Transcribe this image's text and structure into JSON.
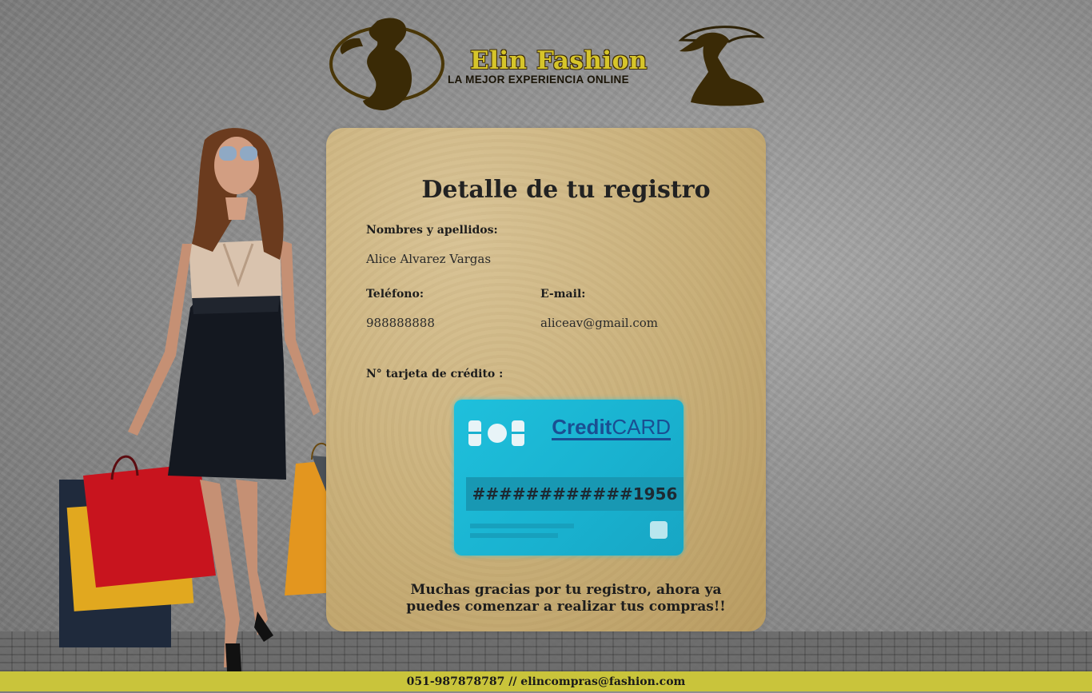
{
  "header": {
    "brand_name": "Elin Fashion",
    "tagline": "LA MEJOR EXPERIENCIA ONLINE"
  },
  "registration": {
    "title": "Detalle de tu registro",
    "name_label": "Nombres y apellidos:",
    "name_value": "Alice Alvarez Vargas",
    "phone_label": "Teléfono:",
    "phone_value": "988888888",
    "email_label": "E-mail:",
    "email_value": "aliceav@gmail.com",
    "card_label": "N° tarjeta de crédito :",
    "card": {
      "brand_bold": "Credit",
      "brand_rest": "CARD",
      "number": "############1956",
      "color": "#1fc0dc"
    },
    "thanks_message": "Muchas gracias por tu registro, ahora ya puedes comenzar a realizar tus compras!!"
  },
  "footer": {
    "contact": "051-987878787 // elincompras@fashion.com"
  },
  "colors": {
    "footer_bg": "#c9c43b",
    "panel_bg": "#c9b07a",
    "brand_text": "#d6c52a"
  }
}
